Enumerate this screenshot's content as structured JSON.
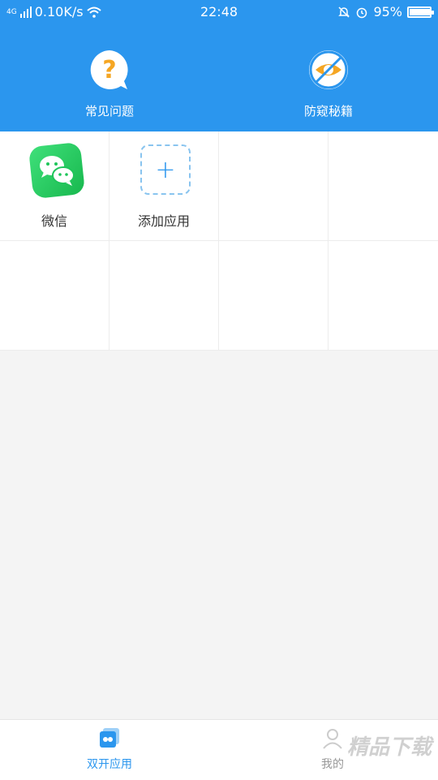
{
  "status_bar": {
    "network": "4G",
    "speed": "0.10K/s",
    "time": "22:48",
    "battery": "95%",
    "battery_level": 0.95
  },
  "header": {
    "faq_label": "常见问题",
    "privacy_label": "防窥秘籍"
  },
  "apps": [
    {
      "label": "微信",
      "icon": "wechat-icon"
    },
    {
      "label": "添加应用",
      "icon": "plus-icon"
    }
  ],
  "bottom_nav": {
    "dual_label": "双开应用",
    "mine_label": "我的"
  },
  "colors": {
    "primary": "#2b96ee",
    "faq_accent": "#f5a623",
    "wechat_green": "#1fc55a"
  },
  "watermark": "精品下载"
}
